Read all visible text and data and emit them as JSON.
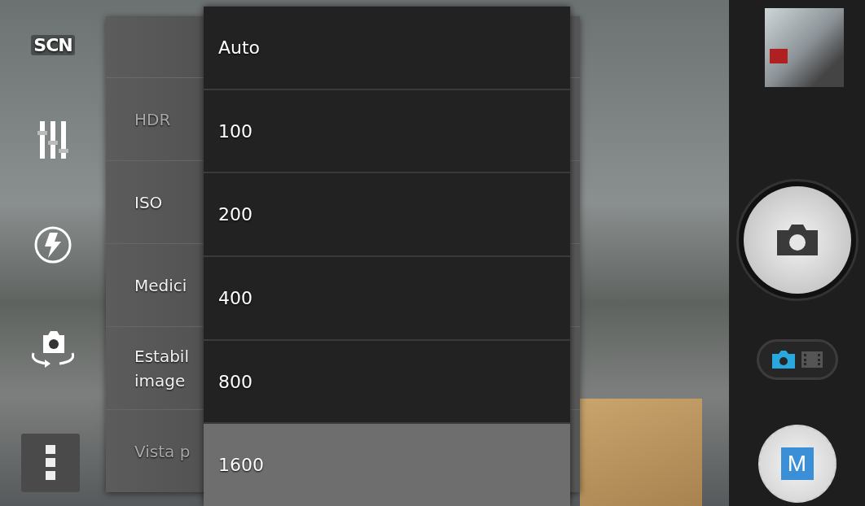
{
  "left_toolbar": {
    "scene_label": "SCN"
  },
  "settings_panel": {
    "rows": [
      {
        "label": "HDR",
        "disabled": true
      },
      {
        "label": "ISO",
        "disabled": false
      },
      {
        "label": "Medici",
        "disabled": false
      },
      {
        "label": "Estabil",
        "label_line2": "image",
        "disabled": false
      },
      {
        "label": "Vista p",
        "disabled": true
      }
    ]
  },
  "iso_menu": {
    "options": [
      {
        "label": "Auto",
        "selected": false
      },
      {
        "label": "100",
        "selected": false
      },
      {
        "label": "200",
        "selected": false
      },
      {
        "label": "400",
        "selected": false
      },
      {
        "label": "800",
        "selected": false
      },
      {
        "label": "1600",
        "selected": true
      }
    ]
  },
  "right_bar": {
    "mode_switch": [
      {
        "kind": "photo",
        "selected": true
      },
      {
        "kind": "video",
        "selected": false
      }
    ],
    "manual_button": {
      "label": "M"
    }
  }
}
